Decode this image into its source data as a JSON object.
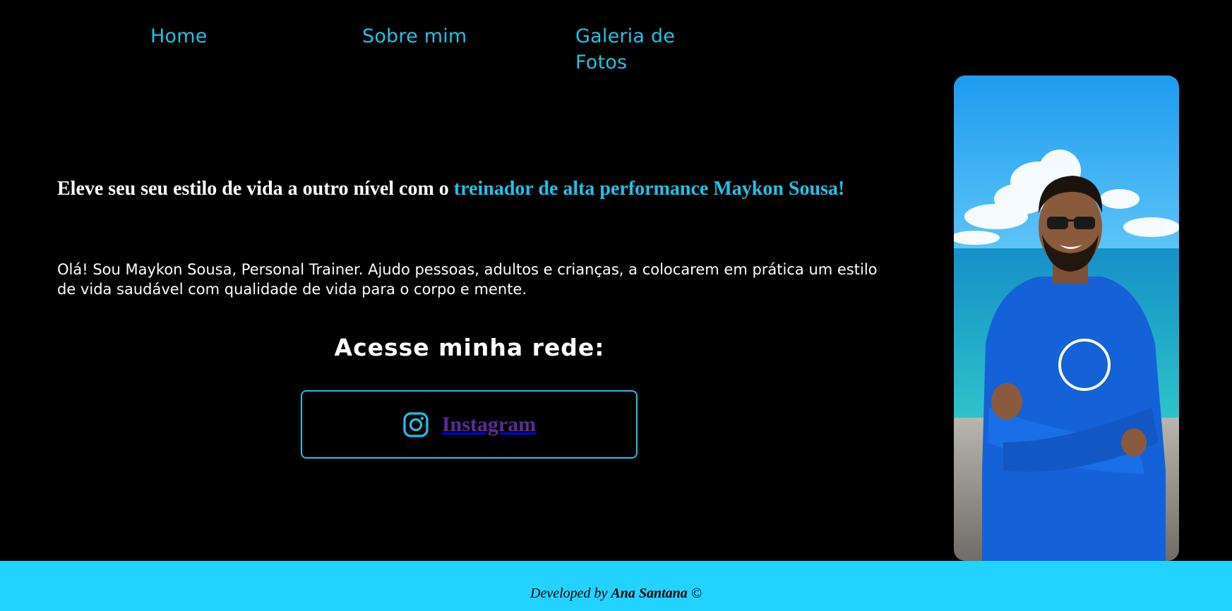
{
  "nav": {
    "home": "Home",
    "about": "Sobre mim",
    "gallery": "Galeria de Fotos"
  },
  "hero": {
    "headline_prefix": "Eleve seu seu estilo de vida a outro nível com o ",
    "headline_accent": "treinador de alta performance Maykon Sousa!",
    "intro": "Olá! Sou Maykon Sousa, Personal Trainer. Ajudo pessoas, adultos e crianças, a colocarem em prática um estilo de vida saudável com qualidade de vida para o corpo e mente."
  },
  "network": {
    "title": "Acesse minha rede:",
    "instagram_label": "Instagram",
    "instagram_icon": "instagram-icon"
  },
  "footer": {
    "prefix": "Developed by ",
    "author": "Ana Santana",
    "suffix": " ©"
  },
  "colors": {
    "background": "#000000",
    "accent": "#1fc3e8",
    "footer_bg": "#22d3ff",
    "instagram_label": "#5b2a9c"
  }
}
